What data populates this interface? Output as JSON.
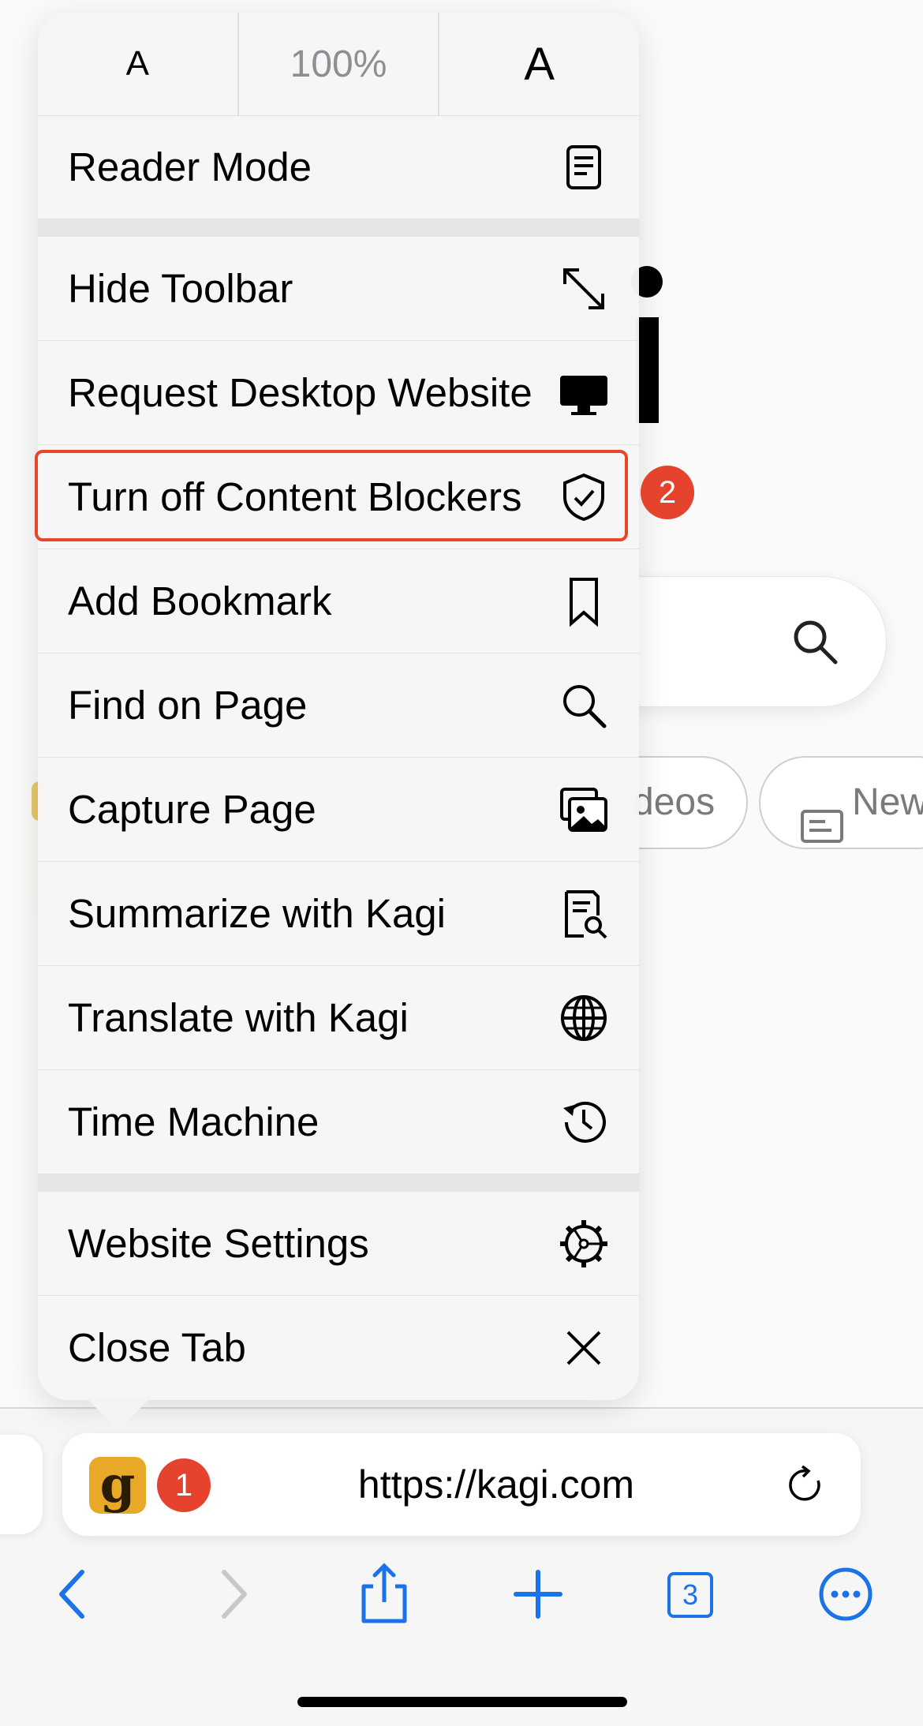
{
  "font_controls": {
    "smaller": "A",
    "zoom": "100%",
    "larger": "A"
  },
  "menu": {
    "items": [
      {
        "label": "Reader Mode",
        "icon": "reader-icon"
      },
      {
        "label": "Hide Toolbar",
        "icon": "expand-arrows-icon"
      },
      {
        "label": "Request Desktop Website",
        "icon": "desktop-icon"
      },
      {
        "label": "Turn off Content Blockers",
        "icon": "shield-check-icon"
      },
      {
        "label": "Add Bookmark",
        "icon": "bookmark-icon"
      },
      {
        "label": "Find on Page",
        "icon": "search-icon"
      },
      {
        "label": "Capture Page",
        "icon": "photos-icon"
      },
      {
        "label": "Summarize with Kagi",
        "icon": "doc-search-icon"
      },
      {
        "label": "Translate with Kagi",
        "icon": "globe-icon"
      },
      {
        "label": "Time Machine",
        "icon": "history-icon"
      },
      {
        "label": "Website Settings",
        "icon": "gear-icon"
      },
      {
        "label": "Close Tab",
        "icon": "close-icon"
      }
    ]
  },
  "annotations": {
    "badge_1": "1",
    "badge_2": "2",
    "highlight_color": "#e5472b"
  },
  "background": {
    "chip_videos": "deos",
    "chip_news": "New"
  },
  "address_bar": {
    "url": "https://kagi.com",
    "site_logo": "g"
  },
  "toolbar": {
    "tab_count": "3",
    "accent": "#1a73e8"
  }
}
